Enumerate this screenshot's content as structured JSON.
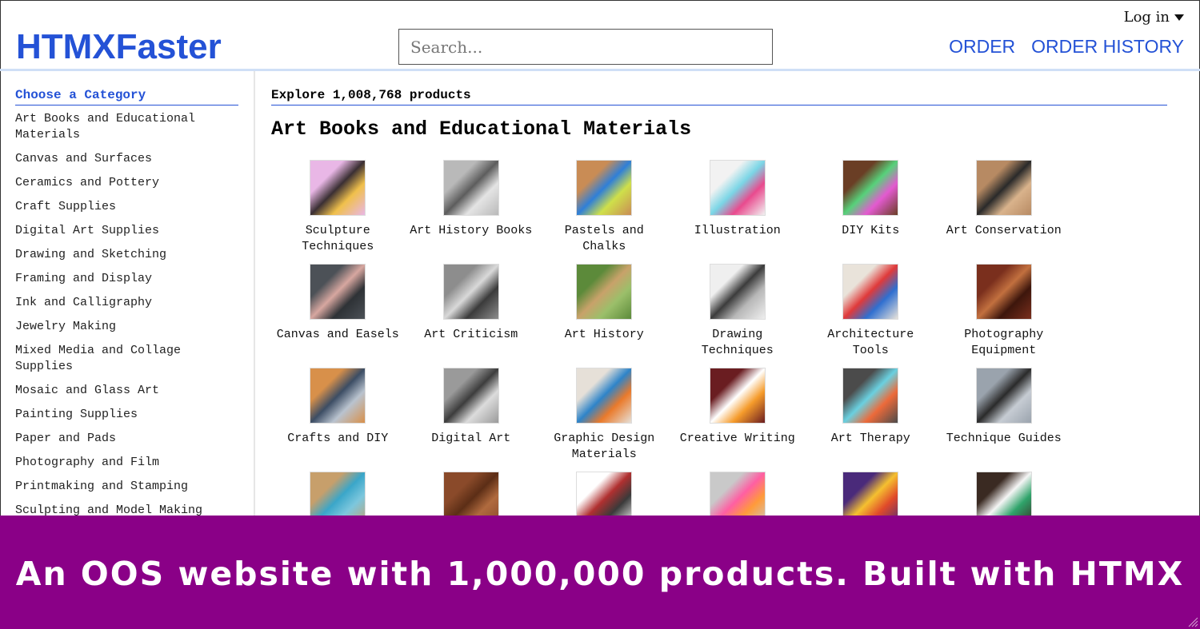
{
  "header": {
    "logo": "HTMXFaster",
    "search_placeholder": "Search...",
    "login_label": "Log in",
    "nav": [
      "ORDER",
      "ORDER HISTORY"
    ]
  },
  "sidebar": {
    "title": "Choose a Category",
    "categories": [
      "Art Books and Educational Materials",
      "Canvas and Surfaces",
      "Ceramics and Pottery",
      "Craft Supplies",
      "Digital Art Supplies",
      "Drawing and Sketching",
      "Framing and Display",
      "Ink and Calligraphy",
      "Jewelry Making",
      "Mixed Media and Collage Supplies",
      "Mosaic and Glass Art",
      "Painting Supplies",
      "Paper and Pads",
      "Photography and Film",
      "Printmaking and Stamping",
      "Sculpting and Model Making"
    ]
  },
  "main": {
    "explore_text": "Explore 1,008,768 products",
    "section_title": "Art Books and Educational Materials",
    "products": [
      {
        "label": "Sculpture Techniques",
        "colors": [
          "#e9b7e6",
          "#3a2f33",
          "#f0c04b"
        ]
      },
      {
        "label": "Art History Books",
        "colors": [
          "#b9b9b9",
          "#5d5d5d",
          "#e4e4e4"
        ]
      },
      {
        "label": "Pastels and Chalks",
        "colors": [
          "#c98c55",
          "#2f7fd8",
          "#cfe04a"
        ]
      },
      {
        "label": "Illustration",
        "colors": [
          "#f2f2f2",
          "#7bd6e6",
          "#e94b8e"
        ]
      },
      {
        "label": "DIY Kits",
        "colors": [
          "#6a3e25",
          "#57d17a",
          "#e35ad0"
        ]
      },
      {
        "label": "Art Conservation",
        "colors": [
          "#b78a63",
          "#2a2a2a",
          "#d9b38c"
        ]
      },
      {
        "label": "Canvas and Easels",
        "colors": [
          "#4c5157",
          "#d7a7a0",
          "#2e3236"
        ]
      },
      {
        "label": "Art Criticism",
        "colors": [
          "#8d8d8d",
          "#d9d9d9",
          "#3b3b3b"
        ]
      },
      {
        "label": "Art History",
        "colors": [
          "#5c8a3a",
          "#c8a26a",
          "#9bbf6a"
        ]
      },
      {
        "label": "Drawing Techniques",
        "colors": [
          "#efefef",
          "#3c3c3c",
          "#b8b8b8"
        ]
      },
      {
        "label": "Architecture Tools",
        "colors": [
          "#e9e3da",
          "#e03a3a",
          "#2f6fd0"
        ]
      },
      {
        "label": "Photography Equipment",
        "colors": [
          "#7a2f1d",
          "#c2703f",
          "#3d160c"
        ]
      },
      {
        "label": "Crafts and DIY",
        "colors": [
          "#d8904a",
          "#3c4d64",
          "#b9c3cf"
        ]
      },
      {
        "label": "Digital Art",
        "colors": [
          "#9a9a9a",
          "#3d3d3d",
          "#dcdcdc"
        ]
      },
      {
        "label": "Graphic Design Materials",
        "colors": [
          "#e6e0d8",
          "#2e84c9",
          "#ea7a2b"
        ]
      },
      {
        "label": "Creative Writing",
        "colors": [
          "#6a1d21",
          "#ffffff",
          "#f59b2b"
        ]
      },
      {
        "label": "Art Therapy",
        "colors": [
          "#4b4b4b",
          "#6ad0e0",
          "#ec6a3a"
        ]
      },
      {
        "label": "Technique Guides",
        "colors": [
          "#9aa3ad",
          "#2b2b2b",
          "#c6ccd3"
        ]
      },
      {
        "label": "",
        "colors": [
          "#c79f6b",
          "#3aa6c9",
          "#7dc7dd"
        ]
      },
      {
        "label": "",
        "colors": [
          "#8a4a2a",
          "#5c2e16",
          "#b06a3e"
        ]
      },
      {
        "label": "",
        "colors": [
          "#ffffff",
          "#b03030",
          "#3a3a3a"
        ]
      },
      {
        "label": "",
        "colors": [
          "#c9c9c9",
          "#ff5fa3",
          "#ff9b3a"
        ]
      },
      {
        "label": "",
        "colors": [
          "#4a2a7a",
          "#f5c030",
          "#e04a2a"
        ]
      },
      {
        "label": "",
        "colors": [
          "#3a2a22",
          "#f5f5f5",
          "#2fa36a"
        ]
      }
    ]
  },
  "banner": {
    "text": "An OOS website with 1,000,000 products. Built with HTMX",
    "color": "#8a0087"
  },
  "colors": {
    "accent": "#2452d6"
  }
}
